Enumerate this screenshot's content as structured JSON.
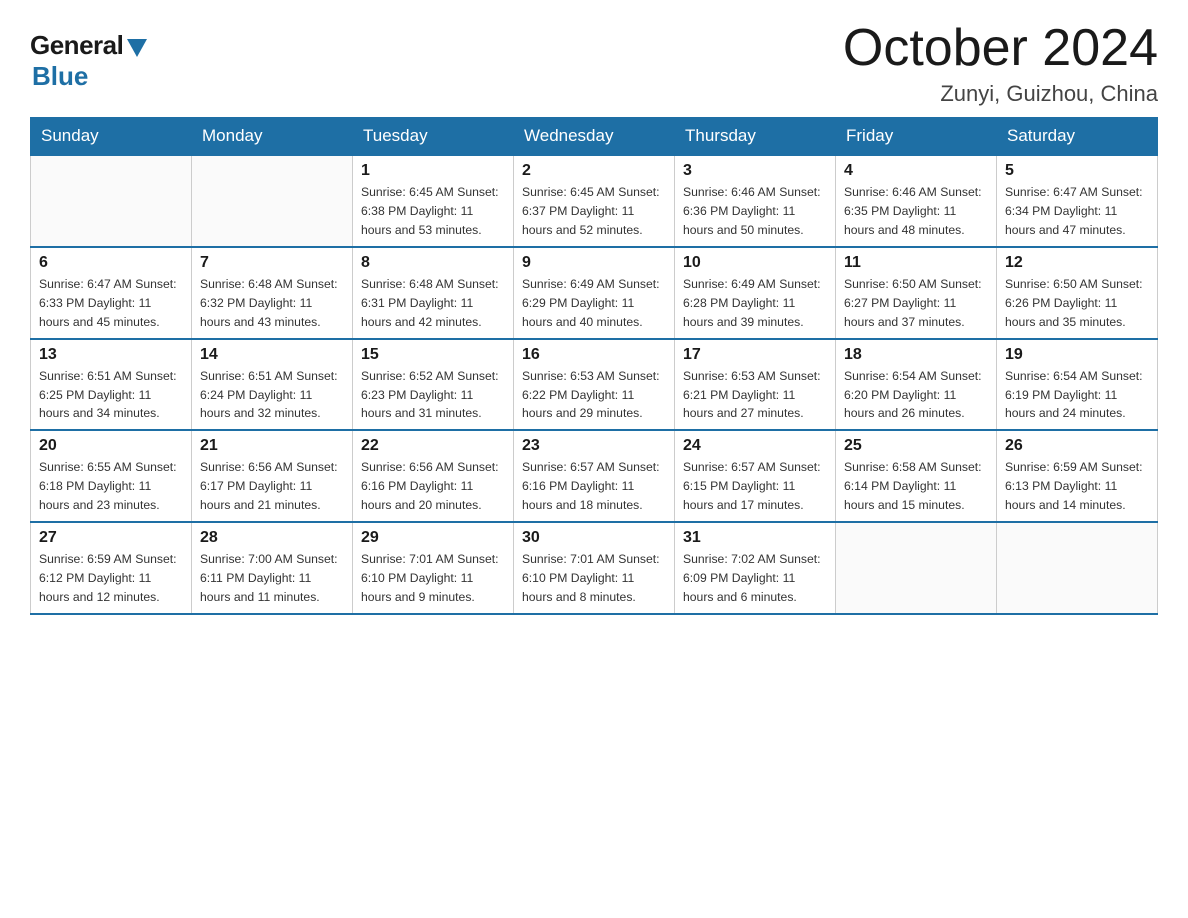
{
  "header": {
    "logo_general": "General",
    "logo_blue": "Blue",
    "month_title": "October 2024",
    "location": "Zunyi, Guizhou, China"
  },
  "days_of_week": [
    "Sunday",
    "Monday",
    "Tuesday",
    "Wednesday",
    "Thursday",
    "Friday",
    "Saturday"
  ],
  "weeks": [
    [
      {
        "day": "",
        "info": ""
      },
      {
        "day": "",
        "info": ""
      },
      {
        "day": "1",
        "info": "Sunrise: 6:45 AM\nSunset: 6:38 PM\nDaylight: 11 hours\nand 53 minutes."
      },
      {
        "day": "2",
        "info": "Sunrise: 6:45 AM\nSunset: 6:37 PM\nDaylight: 11 hours\nand 52 minutes."
      },
      {
        "day": "3",
        "info": "Sunrise: 6:46 AM\nSunset: 6:36 PM\nDaylight: 11 hours\nand 50 minutes."
      },
      {
        "day": "4",
        "info": "Sunrise: 6:46 AM\nSunset: 6:35 PM\nDaylight: 11 hours\nand 48 minutes."
      },
      {
        "day": "5",
        "info": "Sunrise: 6:47 AM\nSunset: 6:34 PM\nDaylight: 11 hours\nand 47 minutes."
      }
    ],
    [
      {
        "day": "6",
        "info": "Sunrise: 6:47 AM\nSunset: 6:33 PM\nDaylight: 11 hours\nand 45 minutes."
      },
      {
        "day": "7",
        "info": "Sunrise: 6:48 AM\nSunset: 6:32 PM\nDaylight: 11 hours\nand 43 minutes."
      },
      {
        "day": "8",
        "info": "Sunrise: 6:48 AM\nSunset: 6:31 PM\nDaylight: 11 hours\nand 42 minutes."
      },
      {
        "day": "9",
        "info": "Sunrise: 6:49 AM\nSunset: 6:29 PM\nDaylight: 11 hours\nand 40 minutes."
      },
      {
        "day": "10",
        "info": "Sunrise: 6:49 AM\nSunset: 6:28 PM\nDaylight: 11 hours\nand 39 minutes."
      },
      {
        "day": "11",
        "info": "Sunrise: 6:50 AM\nSunset: 6:27 PM\nDaylight: 11 hours\nand 37 minutes."
      },
      {
        "day": "12",
        "info": "Sunrise: 6:50 AM\nSunset: 6:26 PM\nDaylight: 11 hours\nand 35 minutes."
      }
    ],
    [
      {
        "day": "13",
        "info": "Sunrise: 6:51 AM\nSunset: 6:25 PM\nDaylight: 11 hours\nand 34 minutes."
      },
      {
        "day": "14",
        "info": "Sunrise: 6:51 AM\nSunset: 6:24 PM\nDaylight: 11 hours\nand 32 minutes."
      },
      {
        "day": "15",
        "info": "Sunrise: 6:52 AM\nSunset: 6:23 PM\nDaylight: 11 hours\nand 31 minutes."
      },
      {
        "day": "16",
        "info": "Sunrise: 6:53 AM\nSunset: 6:22 PM\nDaylight: 11 hours\nand 29 minutes."
      },
      {
        "day": "17",
        "info": "Sunrise: 6:53 AM\nSunset: 6:21 PM\nDaylight: 11 hours\nand 27 minutes."
      },
      {
        "day": "18",
        "info": "Sunrise: 6:54 AM\nSunset: 6:20 PM\nDaylight: 11 hours\nand 26 minutes."
      },
      {
        "day": "19",
        "info": "Sunrise: 6:54 AM\nSunset: 6:19 PM\nDaylight: 11 hours\nand 24 minutes."
      }
    ],
    [
      {
        "day": "20",
        "info": "Sunrise: 6:55 AM\nSunset: 6:18 PM\nDaylight: 11 hours\nand 23 minutes."
      },
      {
        "day": "21",
        "info": "Sunrise: 6:56 AM\nSunset: 6:17 PM\nDaylight: 11 hours\nand 21 minutes."
      },
      {
        "day": "22",
        "info": "Sunrise: 6:56 AM\nSunset: 6:16 PM\nDaylight: 11 hours\nand 20 minutes."
      },
      {
        "day": "23",
        "info": "Sunrise: 6:57 AM\nSunset: 6:16 PM\nDaylight: 11 hours\nand 18 minutes."
      },
      {
        "day": "24",
        "info": "Sunrise: 6:57 AM\nSunset: 6:15 PM\nDaylight: 11 hours\nand 17 minutes."
      },
      {
        "day": "25",
        "info": "Sunrise: 6:58 AM\nSunset: 6:14 PM\nDaylight: 11 hours\nand 15 minutes."
      },
      {
        "day": "26",
        "info": "Sunrise: 6:59 AM\nSunset: 6:13 PM\nDaylight: 11 hours\nand 14 minutes."
      }
    ],
    [
      {
        "day": "27",
        "info": "Sunrise: 6:59 AM\nSunset: 6:12 PM\nDaylight: 11 hours\nand 12 minutes."
      },
      {
        "day": "28",
        "info": "Sunrise: 7:00 AM\nSunset: 6:11 PM\nDaylight: 11 hours\nand 11 minutes."
      },
      {
        "day": "29",
        "info": "Sunrise: 7:01 AM\nSunset: 6:10 PM\nDaylight: 11 hours\nand 9 minutes."
      },
      {
        "day": "30",
        "info": "Sunrise: 7:01 AM\nSunset: 6:10 PM\nDaylight: 11 hours\nand 8 minutes."
      },
      {
        "day": "31",
        "info": "Sunrise: 7:02 AM\nSunset: 6:09 PM\nDaylight: 11 hours\nand 6 minutes."
      },
      {
        "day": "",
        "info": ""
      },
      {
        "day": "",
        "info": ""
      }
    ]
  ]
}
